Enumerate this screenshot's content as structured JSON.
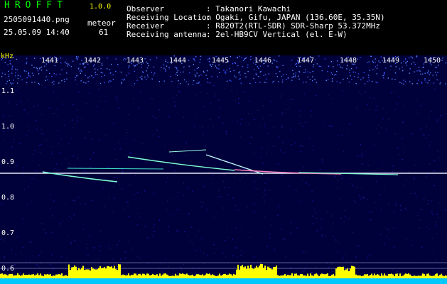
{
  "header": {
    "title": "HROFFT",
    "version": "1.0.0",
    "filename": "2505091440.png",
    "datetime": "25.05.09 14:40",
    "meteor_label": "meteor",
    "meteor_count": "61"
  },
  "info": [
    {
      "label": "Observer",
      "value": ": Takanori Kawachi"
    },
    {
      "label": "Receiving Location",
      "value": ": Ogaki, Gifu, JAPAN (136.60E, 35.35N)"
    },
    {
      "label": "Receiver",
      "value": ": R820T2(RTL-SDR) SDR-Sharp 53.372MHz"
    },
    {
      "label": "Receiving antenna",
      "value": ": 2el-HB9CV Vertical (el. E-W)"
    }
  ],
  "axis": {
    "unit": "kHz",
    "y_ticks": [
      "1.1",
      "1.0",
      "0.9",
      "0.8",
      "0.7",
      "0.6"
    ],
    "x_ticks": [
      "1441",
      "1442",
      "1443",
      "1444",
      "1445",
      "1446",
      "1447",
      "1448",
      "1449",
      "1450"
    ]
  },
  "colors": {
    "carrier": "#e8e8ff",
    "trail": "#7fffd4",
    "level": "#ffff00",
    "noise": "#0a0a80"
  }
}
